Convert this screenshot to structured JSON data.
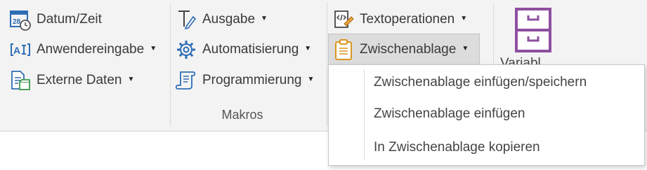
{
  "ribbon": {
    "col1": [
      {
        "label": "Datum/Zeit",
        "icon": "calendar-clock-icon",
        "caret": false
      },
      {
        "label": "Anwendereingabe",
        "icon": "text-input-icon",
        "caret": true
      },
      {
        "label": "Externe Daten",
        "icon": "external-data-icon",
        "caret": true
      }
    ],
    "col2": [
      {
        "label": "Ausgabe",
        "icon": "text-output-icon",
        "caret": true
      },
      {
        "label": "Automatisierung",
        "icon": "gear-icon",
        "caret": true
      },
      {
        "label": "Programmierung",
        "icon": "script-scroll-icon",
        "caret": true
      }
    ],
    "col3": [
      {
        "label": "Textoperationen",
        "icon": "code-document-icon",
        "caret": true
      },
      {
        "label": "Zwischenablage",
        "icon": "clipboard-icon",
        "caret": true,
        "active": true
      }
    ],
    "group_label": "Makros",
    "variable_label": "Variabl",
    "accent_color": "#8e4fa0"
  },
  "dropdown": {
    "items": [
      "Zwischenablage einfügen/speichern",
      "Zwischenablage einfügen",
      "In Zwischenablage kopieren"
    ]
  }
}
